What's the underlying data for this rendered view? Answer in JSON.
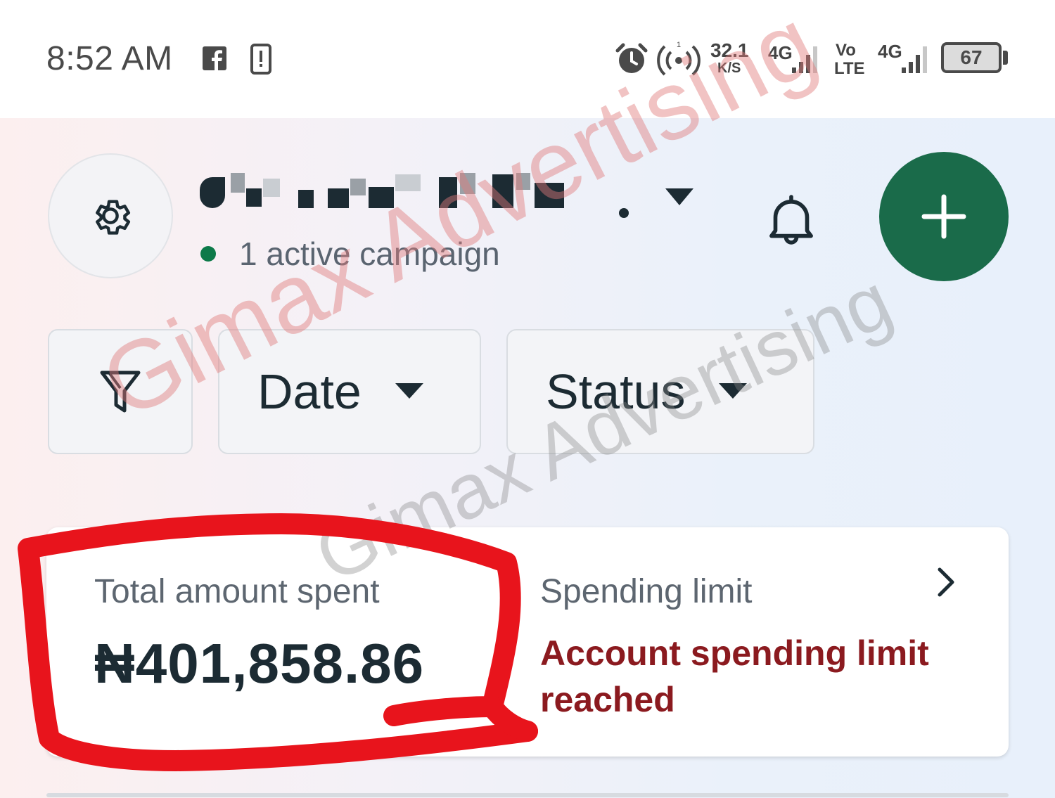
{
  "status_bar": {
    "time": "8:52 AM",
    "net_speed_value": "32.1",
    "net_speed_unit": "K/S",
    "sim1_label": "4G",
    "volte_top": "Vo",
    "volte_bottom": "LTE",
    "sim2_label": "4G",
    "battery": "67",
    "icons": [
      "facebook-icon",
      "phone-alert-icon",
      "alarm-icon",
      "hotspot-icon",
      "signal-icon",
      "battery-icon"
    ]
  },
  "header": {
    "active_campaigns": "1 active campaign",
    "icons": [
      "gear-icon",
      "caret-down-icon",
      "bell-icon",
      "plus-icon"
    ],
    "colors": {
      "create_button": "#1a6b4a",
      "active_dot": "#0d7a49"
    }
  },
  "filters": {
    "date_label": "Date",
    "status_label": "Status",
    "icons": [
      "filter-icon",
      "caret-down-icon"
    ]
  },
  "summary": {
    "total_label": "Total amount spent",
    "total_value": "₦401,858.86",
    "limit_label": "Spending limit",
    "limit_status": "Account spending limit reached",
    "colors": {
      "limit_status": "#8b1a1f"
    }
  },
  "watermark": {
    "text": "Gimax Advertising"
  },
  "annotation": {
    "color": "#e8141c"
  }
}
